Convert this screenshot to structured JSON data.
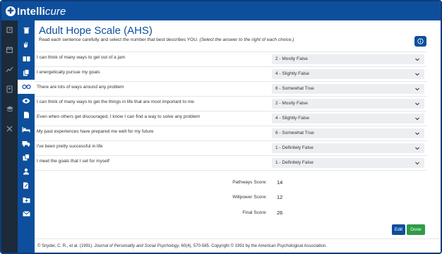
{
  "app": {
    "brand_prefix": "Intelli",
    "brand_suffix": "cure"
  },
  "page": {
    "title": "Adult Hope Scale (AHS)",
    "instructions": "Read each sentence carefully and select the number that best describes YOU.",
    "instructions_hint": "(Select the answer to the right of each choice.)"
  },
  "questions": [
    {
      "text": "I can think of many ways to get out of a jam",
      "answer": "2 - Mostly False"
    },
    {
      "text": "I energetically pursue my goals",
      "answer": "4 - Slightly False"
    },
    {
      "text": "There are lots of ways around any problem",
      "answer": "6 - Somewhat True"
    },
    {
      "text": "I can think of many ways to get the things in life that are most important to me",
      "answer": "2 - Mostly False"
    },
    {
      "text": "Even when others get discouraged, I know I can find a way to solve any problem",
      "answer": "4 - Slightly False"
    },
    {
      "text": "My past experiences have prepared me well for my future",
      "answer": "6 - Somewhat True"
    },
    {
      "text": "I've been pretty successful in life",
      "answer": "1 - Definitely False"
    },
    {
      "text": "I meet the goals that I set for myself",
      "answer": "1 - Definitely False"
    }
  ],
  "scores": [
    {
      "label": "Pathways Score:",
      "value": "14"
    },
    {
      "label": "Willpower Score:",
      "value": "12"
    },
    {
      "label": "Final Score:",
      "value": "26"
    }
  ],
  "actions": {
    "edit_label": "Edit",
    "done_label": "Done"
  },
  "footer": {
    "pre": "© Snyder, C. R., et al. (1991).",
    "journal": "Journal of Personality and Social Psychology",
    "post": ", 60(4), 570-585. Copyright © 1991 by the American Psychological Association."
  },
  "icons": {
    "rail1": [
      "dashboard-icon",
      "calendar-icon",
      "analytics-icon",
      "contact-card-icon",
      "graduation-cap-icon",
      "tools-icon"
    ],
    "rail2": [
      "trash-icon",
      "hand-icon",
      "book-icon",
      "clipboard-icon",
      "glasses-icon",
      "eye-icon",
      "document-icon",
      "bed-icon",
      "truck-icon",
      "copy-icon",
      "person-icon",
      "edit-document-icon",
      "folder-plus-icon",
      "mail-icon"
    ]
  },
  "colors": {
    "brand": "#0d4f9c",
    "rail_dark": "#1c2a3a",
    "done": "#2e9b47"
  }
}
